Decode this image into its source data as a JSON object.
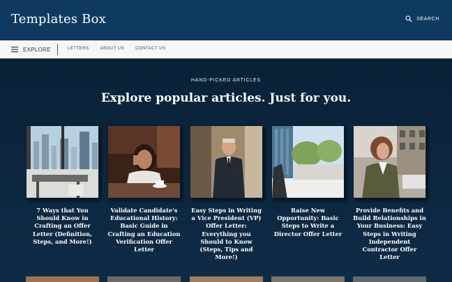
{
  "header": {
    "brand": "Templates Box",
    "search_label": "SEARCH"
  },
  "nav": {
    "explore_label": "EXPLORE",
    "links": [
      "LETTERS",
      "ABOUT US",
      "CONTACT US"
    ]
  },
  "main": {
    "kicker": "HAND-PICKED ARTICLES",
    "headline": "Explore popular articles. Just for you.",
    "articles": [
      {
        "title": "7 Ways that You Should Know in Crafting an Offer Letter (Definition, Steps, and More!)"
      },
      {
        "title": "Validate Candidate's Educational History: Basic Guide in Crafting an Education Verification Offer Letter"
      },
      {
        "title": "Easy Steps in Writing a Vice President (VP) Offer Letter: Everything you Should to Know (Steps, Tips and More!)"
      },
      {
        "title": "Raise New Opportunity: Basic Steps to Write a Director Offer Letter"
      },
      {
        "title": "Provide Benefits and Build Relationships in Your Business: Easy Steps in Writing Independent Contractor Offer Letter"
      }
    ]
  },
  "colors": {
    "header_bg": "#0f3a60",
    "nav_bg": "#f6f6f6",
    "main_bg": "#0e2b45",
    "text": "#ffffff"
  }
}
